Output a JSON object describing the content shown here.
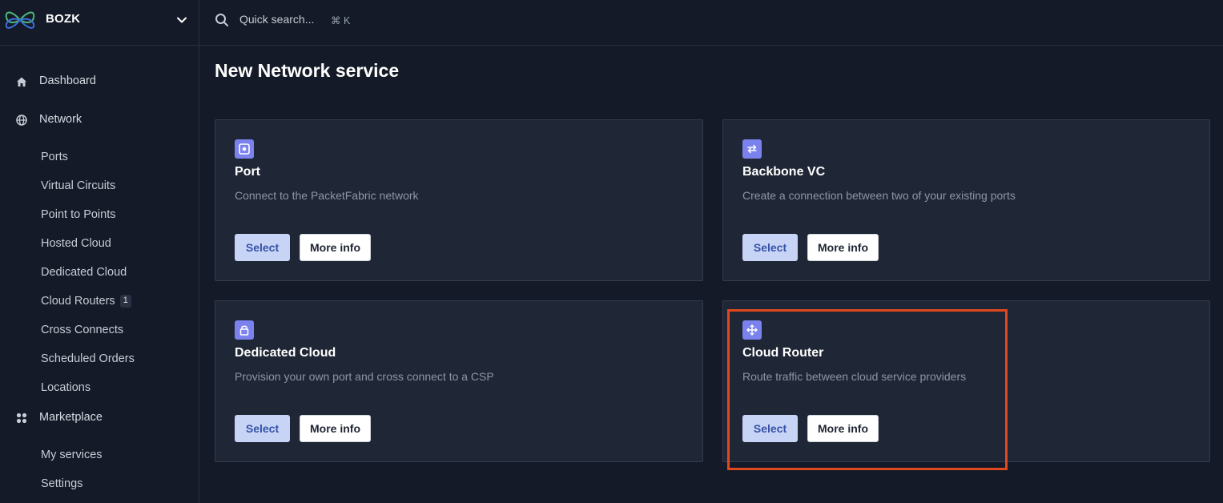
{
  "org": {
    "name": "BOZK"
  },
  "search": {
    "placeholder": "Quick search...",
    "shortcut": "⌘ K"
  },
  "nav": {
    "dashboard": "Dashboard",
    "network": "Network",
    "network_items": [
      {
        "label": "Ports"
      },
      {
        "label": "Virtual Circuits"
      },
      {
        "label": "Point to Points"
      },
      {
        "label": "Hosted Cloud"
      },
      {
        "label": "Dedicated Cloud"
      },
      {
        "label": "Cloud Routers",
        "badge": "1"
      },
      {
        "label": "Cross Connects"
      },
      {
        "label": "Scheduled Orders"
      },
      {
        "label": "Locations"
      }
    ],
    "marketplace": "Marketplace",
    "marketplace_items": [
      {
        "label": "My services"
      },
      {
        "label": "Settings"
      }
    ]
  },
  "page": {
    "title": "New Network service"
  },
  "cards": [
    {
      "title": "Port",
      "description": "Connect to the PacketFabric network",
      "icon": "port-icon",
      "select_label": "Select",
      "more_label": "More info"
    },
    {
      "title": "Backbone VC",
      "description": "Create a connection between two of your existing ports",
      "icon": "swap-arrows-icon",
      "select_label": "Select",
      "more_label": "More info"
    },
    {
      "title": "Dedicated Cloud",
      "description": "Provision your own port and cross connect to a CSP",
      "icon": "lock-icon",
      "select_label": "Select",
      "more_label": "More info"
    },
    {
      "title": "Cloud Router",
      "description": "Route traffic between cloud service providers",
      "icon": "move-arrows-icon",
      "select_label": "Select",
      "more_label": "More info"
    }
  ],
  "colors": {
    "background": "#141a27",
    "card": "#1f2635",
    "icon_accent": "#7b82ee",
    "select_button": "#c7d4f5",
    "highlight": "#e0481f"
  }
}
